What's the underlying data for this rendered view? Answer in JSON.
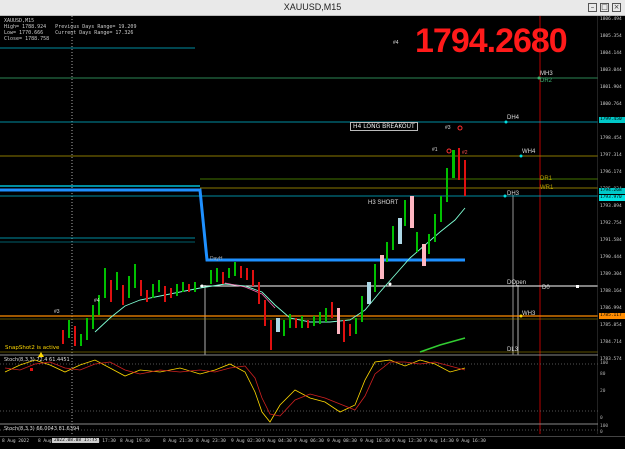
{
  "window": {
    "title": "XAUUSD,M15"
  },
  "info_box": {
    "symbol": "XAUUSD,M15",
    "lines": [
      "High= 1788.924   Previous Days Range= 19.209",
      "Low= 1770.666    Current Days Range= 17.326",
      "Close= 1788.758"
    ]
  },
  "big_price": "1794.2680",
  "price_axis": [
    "1806.494",
    "1805.354",
    "1804.144",
    "1803.044",
    "1801.904",
    "1800.764",
    "1799.624",
    "1798.454",
    "1797.314",
    "1796.174",
    "1795.034",
    "1793.894",
    "1792.754",
    "1791.584",
    "1790.444",
    "1789.304",
    "1788.164",
    "1786.994",
    "1785.854",
    "1784.714",
    "1783.574"
  ],
  "price_tags": [
    {
      "text": "1799.450",
      "color": "#00c8c8"
    },
    {
      "text": "1794.268",
      "color": "#00c8c8"
    },
    {
      "text": "1793.970",
      "color": "#00e0e0"
    },
    {
      "text": "1785.117",
      "color": "#ff8c00"
    }
  ],
  "labels": {
    "mh3": "MH3",
    "dr2": "DR2",
    "dh4": "DH4",
    "wh4": "WH4",
    "dr1": "DR1",
    "wr1": "WR1",
    "dh3": "DH3",
    "h4_long": "H4 LONG BREAKOUT",
    "h3_short": "H3 SHORT",
    "dayh": "DayH",
    "dopen": "DOpen",
    "d0": "D0",
    "wh3": "WH3",
    "dl3": "DL3",
    "n4a": "#4",
    "n3a": "#3",
    "n1": "#1",
    "n4b": "#4",
    "n3b": "#3",
    "n2": "#2"
  },
  "snapshot_text": "SnapShot2 is active",
  "stoch1_label": "Stoch(8,3,3) 72.4 61.4451",
  "stoch1_axis": [
    "100",
    "80",
    "20",
    "0"
  ],
  "stoch2_label": "Stoch(8,3,3) 66.0043 81.6394",
  "stoch2_axis": [
    "100",
    "0"
  ],
  "time_axis": [
    "8 Aug 2022",
    "8 Aug",
    "8 Aug 17:30",
    "8 Aug 19:30",
    "8 Aug 21:30",
    "8 Aug 23:30",
    "9 Aug 02:30",
    "9 Aug 04:30",
    "9 Aug 06:30",
    "9 Aug 08:30",
    "9 Aug 10:30",
    "9 Aug 12:30",
    "9 Aug 14:30",
    "9 Aug 16:30"
  ],
  "time_cursor": "2022.08.08 15:45",
  "colors": {
    "bull": "#00c000",
    "bear": "#e01010",
    "cyan": "#00bcd4",
    "yellow": "#ffd800",
    "red_line": "#8b0000",
    "blue": "#1e90ff"
  }
}
